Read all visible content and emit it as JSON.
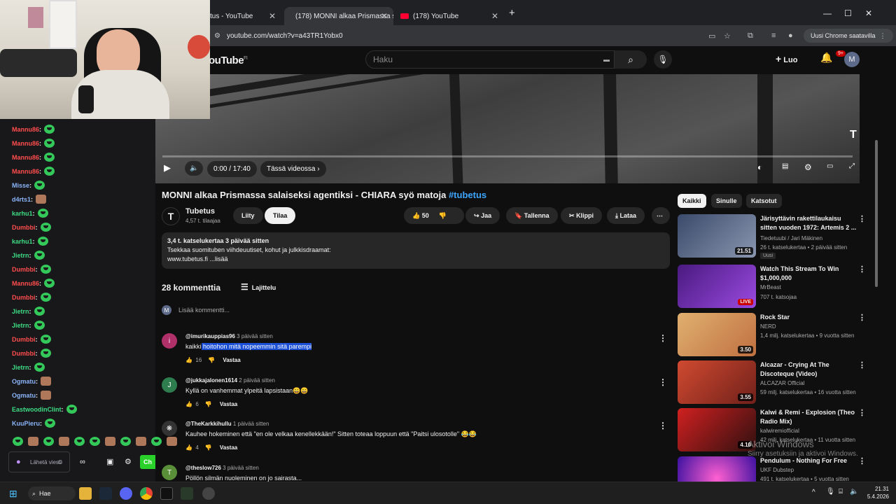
{
  "browser": {
    "tabs": [
      {
        "label": "tus - YouTube"
      },
      {
        "label": "(178) MONNI alkaa Prismassa s"
      },
      {
        "label": "(178) YouTube"
      }
    ],
    "url": "youtube.com/watch?v=a43TR1Yobx0",
    "profile_button": "Uusi Chrome saatavilla"
  },
  "yt_header": {
    "logo": "ouTube",
    "logo_region": "FI",
    "search_placeholder": "Haku",
    "create_label": "Luo",
    "notif_badge": "9+",
    "avatar_letter": "M"
  },
  "player": {
    "time": "0:00 / 17:40",
    "in_video": "Tässä videossa",
    "progress": 0
  },
  "video": {
    "title": "MONNI alkaa Prismassa salaiseksi agentiksi - CHIARA syö matoja",
    "hashtag": "#tubetus",
    "channel_name": "Tubetus",
    "channel_subs": "4,57 t. tilaajaa",
    "join_label": "Liity",
    "subscribe_label": "Tilaa",
    "likes": "50",
    "share_label": "Jaa",
    "save_label": "Tallenna",
    "clip_label": "Klippi",
    "download_label": "Lataa",
    "desc_stats": "3,4 t. katselukertaa  3 päivää sitten",
    "desc_line1": "Tsekkaa suomituben viihdeuutiset, kohut ja julkkisdraamat:",
    "desc_line2": "www.tubetus.fi ...lisää"
  },
  "comments": {
    "count_label": "28 kommenttia",
    "sort_label": "Lajittelu",
    "add_placeholder": "Lisää kommentti...",
    "user_avatar": "M",
    "reply_label": "Vastaa",
    "items": [
      {
        "avatar": "i",
        "color": "#b0306a",
        "author": "@imurikauppias96",
        "time": "3 päivää sitten",
        "text_pre": "kaikki",
        "text_hl": " hoitohon mitä nopeemmin sitä parempi",
        "likes": "16"
      },
      {
        "avatar": "J",
        "color": "#2e7d4f",
        "author": "@jukkajalonen1614",
        "time": "2 päivää sitten",
        "text_pre": "Kyllä on vanhemmat ylpeitä lapsistaan😄😄",
        "text_hl": "",
        "likes": "6"
      },
      {
        "avatar": "",
        "color": "#444",
        "author": "@TheKarkkihullu",
        "time": "1 päivää sitten",
        "text_pre": "Kauhee hokeminen että \"en ole velkaa kenellekkään!\" Sitten toteaa loppuun että \"Paitsi ulosotolle\" 😂😂",
        "text_hl": "",
        "likes": "4"
      },
      {
        "avatar": "T",
        "color": "#5a8f3a",
        "author": "@theslow726",
        "time": "3 päivää sitten",
        "text_pre": "Pöllön silmän nuoleminen on jo sairasta...",
        "text_hl": "",
        "likes": ""
      }
    ]
  },
  "sidebar": {
    "chips": [
      "Kaikki",
      "Sinulle",
      "Katsotut"
    ],
    "items": [
      {
        "title": "Järisyttävin rakettilaukaisu sitten vuoden 1972: Artemis 2 ...",
        "channel": "Tiedetuubi / Jari Mäkinen",
        "meta": "26 t. katselukertaa • 2 päivää sitten",
        "duration": "21.51",
        "badge": "Uusi",
        "thumb": "#3a4a6a"
      },
      {
        "title": "Watch This Stream To Win $1,000,000",
        "channel": "MrBeast",
        "meta": "707 t. katsojaa",
        "duration": "LIVE",
        "badge": "",
        "thumb": "#6b2fb0"
      },
      {
        "title": "Rock Star",
        "channel": "NERD",
        "meta": "1,4 milj. katselukertaa • 9 vuotta sitten",
        "duration": "3.50",
        "badge": "",
        "thumb": "#d89a60"
      },
      {
        "title": "Alcazar - Crying At The Discoteque (Video)",
        "channel": "ALCAZAR Official",
        "meta": "59 milj. katselukertaa • 16 vuotta sitten",
        "duration": "3.55",
        "badge": "",
        "thumb": "#b03a2a"
      },
      {
        "title": "Kalwi & Remi - Explosion (Theo Radio Mix)",
        "channel": "kalwiremiofficial",
        "meta": "42 milj. katselukertaa • 11 vuotta sitten",
        "duration": "4.10",
        "badge": "",
        "thumb": "#c02020"
      },
      {
        "title": "Pendulum - Nothing For Free",
        "channel": "UKF Dubstep",
        "meta": "491 t. katselukertaa • 5 vuotta sitten",
        "duration": "",
        "badge": "",
        "thumb": "#7a2ac0"
      }
    ]
  },
  "chat": {
    "lines": [
      {
        "user": "Mannu86",
        "color": "#ff4d4d"
      },
      {
        "user": "Mannu86",
        "color": "#ff4d4d"
      },
      {
        "user": "Mannu86",
        "color": "#ff4d4d"
      },
      {
        "user": "Mannu86",
        "color": "#ff4d4d"
      },
      {
        "user": "Misse",
        "color": "#8ab4f8"
      },
      {
        "user": "d4rts1",
        "color": "#8ab4f8"
      },
      {
        "user": "karhu1",
        "color": "#3ddc84"
      },
      {
        "user": "Dumbbi",
        "color": "#ff4d4d"
      },
      {
        "user": "karhu1",
        "color": "#3ddc84"
      },
      {
        "user": "Jietrn",
        "color": "#3ddc84"
      },
      {
        "user": "Dumbbi",
        "color": "#ff4d4d"
      },
      {
        "user": "Mannu86",
        "color": "#ff4d4d"
      },
      {
        "user": "Dumbbi",
        "color": "#ff4d4d"
      },
      {
        "user": "Jietrn",
        "color": "#3ddc84"
      },
      {
        "user": "Jietrn",
        "color": "#3ddc84"
      },
      {
        "user": "Dumbbi",
        "color": "#ff4d4d"
      },
      {
        "user": "Dumbbi",
        "color": "#ff4d4d"
      },
      {
        "user": "Jietrn",
        "color": "#3ddc84"
      },
      {
        "user": "Ogmatu",
        "color": "#8ab4f8"
      },
      {
        "user": "Ogmatu",
        "color": "#8ab4f8"
      },
      {
        "user": "EastwoodinClint",
        "color": "#3ddc84"
      },
      {
        "user": "KuuPieru",
        "color": "#8ab4f8"
      }
    ],
    "send_placeholder": "Lähetä viesti",
    "chat_button": "Ch"
  },
  "taskbar": {
    "search": "Hae",
    "time": "21.31",
    "date": "5.4.2026"
  },
  "activate_windows": {
    "line1": "Aktivoi Windows",
    "line2": "Siirry asetuksiin ja aktivoi Windows."
  }
}
